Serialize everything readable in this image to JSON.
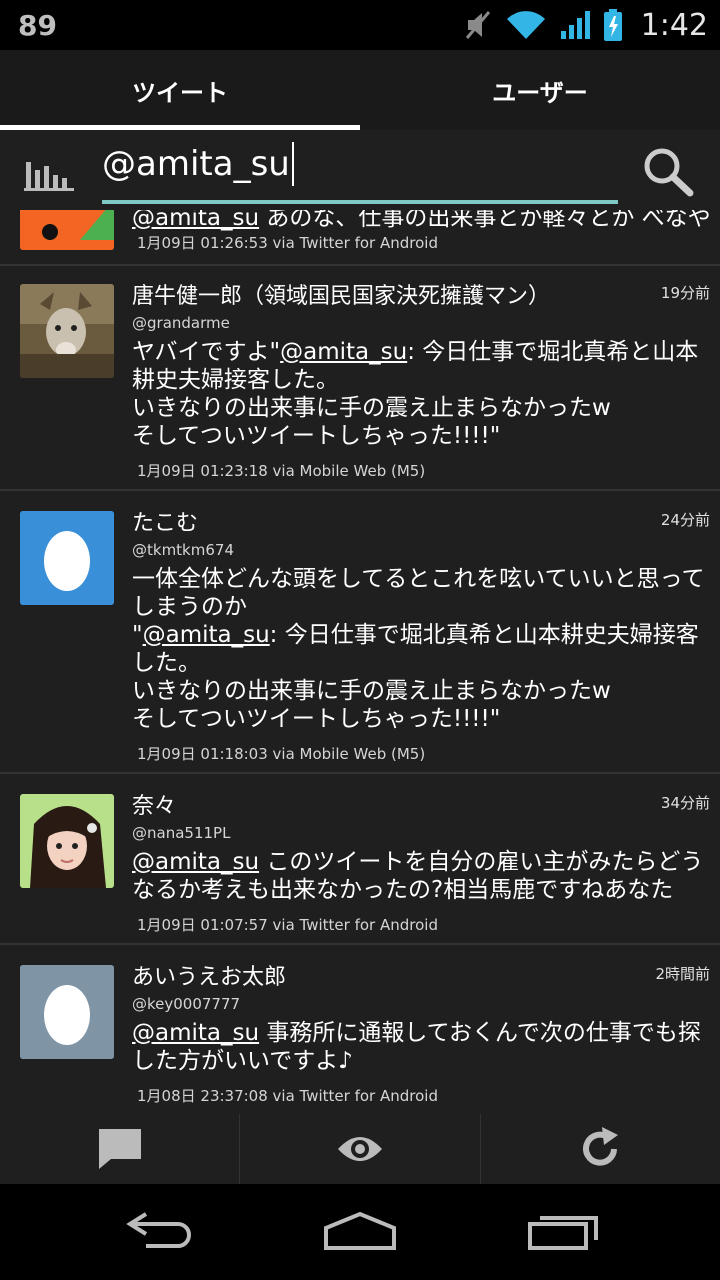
{
  "status": {
    "battery_level": "89",
    "time": "1:42",
    "icons": [
      "mute-icon",
      "wifi-icon",
      "signal-icon",
      "battery-icon"
    ]
  },
  "tabs": [
    {
      "label": "ツイート",
      "active": true
    },
    {
      "label": "ユーザー",
      "active": false
    }
  ],
  "search": {
    "query": "@amita_su"
  },
  "tweets": [
    {
      "partial": true,
      "body_mention": "@amita_su",
      "body_rest": " あのな、仕事の出来事とか軽々とか べなや",
      "meta": "1月09日 01:26:53 via Twitter for Android"
    },
    {
      "name": "唐牛健一郎（領域国民国家決死擁護マン）",
      "time": "19分前",
      "handle": "@grandarme",
      "body_pre": "ヤバイですよ\"",
      "body_mention": "@amita_su",
      "body_post": ": 今日仕事で堀北真希と山本耕史夫婦接客した。\nいきなりの出来事に手の震え止まらなかったw\nそしてついツイートしちゃった!!!!\"",
      "meta": "1月09日 01:23:18 via Mobile Web (M5)"
    },
    {
      "name": "たこむ",
      "time": "24分前",
      "handle": "@tkmtkm674",
      "body_pre": "一体全体どんな頭をしてるとこれを呟いていいと思ってしまうのか\n\"",
      "body_mention": "@amita_su",
      "body_post": ": 今日仕事で堀北真希と山本耕史夫婦接客した。\nいきなりの出来事に手の震え止まらなかったw\nそしてついツイートしちゃった!!!!\"",
      "meta": "1月09日 01:18:03 via Mobile Web (M5)"
    },
    {
      "name": "奈々",
      "time": "34分前",
      "handle": "@nana511PL",
      "body_pre": "",
      "body_mention": "@amita_su",
      "body_post": " このツイートを自分の雇い主がみたらどうなるか考えも出来なかったの?相当馬鹿ですねあなた",
      "meta": "1月09日 01:07:57 via Twitter for Android"
    },
    {
      "name": "あいうえお太郎",
      "time": "2時間前",
      "handle": "@key0007777",
      "body_pre": "",
      "body_mention": "@amita_su",
      "body_post": " 事務所に通報しておくんで次の仕事でも探した方がいいですよ♪",
      "meta": "1月08日 23:37:08 via Twitter for Android"
    }
  ],
  "colors": {
    "accent": "#7fc8c6",
    "egg_blue": "#3a8fd9",
    "egg_gray": "#7f95a6"
  },
  "actions": [
    "compose-icon",
    "eye-icon",
    "refresh-icon"
  ],
  "nav": [
    "back-icon",
    "home-icon",
    "recent-apps-icon"
  ]
}
